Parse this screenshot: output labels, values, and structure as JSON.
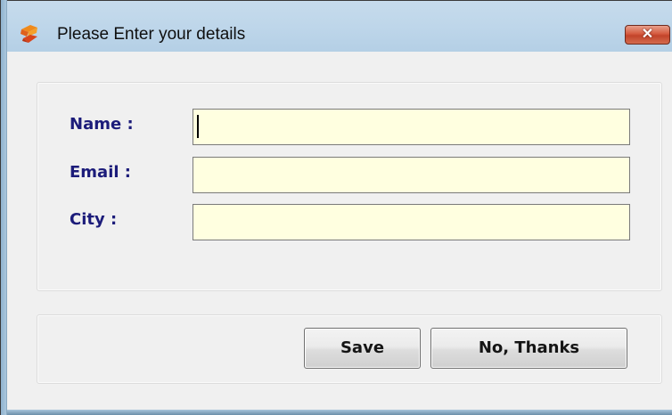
{
  "window": {
    "title": "Please Enter your details",
    "close_label": "✕",
    "app_icon": "app-logo-icon",
    "accent_color": "#1c1c7a",
    "input_background": "#ffffe0"
  },
  "form": {
    "fields": [
      {
        "label": "Name :",
        "value": "",
        "focused": true
      },
      {
        "label": "Email :",
        "value": "",
        "focused": false
      },
      {
        "label": "City :",
        "value": "",
        "focused": false
      }
    ]
  },
  "actions": {
    "save_label": "Save",
    "no_thanks_label": "No, Thanks"
  }
}
